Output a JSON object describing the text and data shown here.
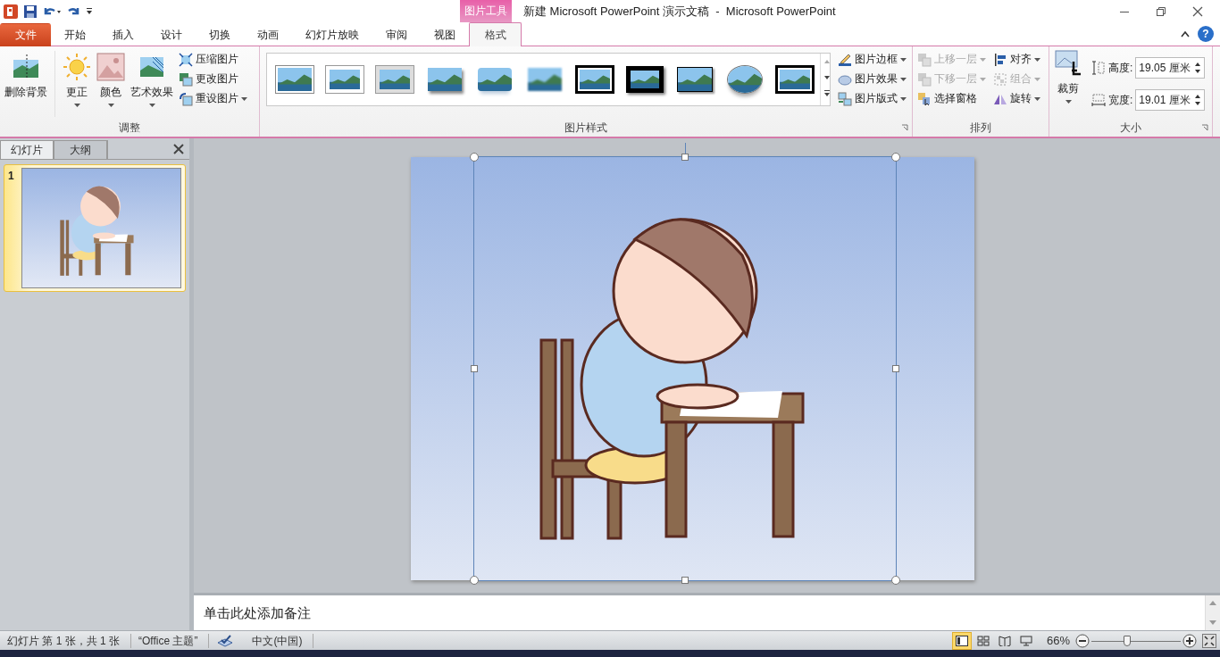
{
  "title_bar": {
    "title": "新建 Microsoft PowerPoint 演示文稿  -  Microsoft PowerPoint",
    "context_tab_group": "图片工具"
  },
  "tabs": [
    {
      "label": "文件",
      "kind": "file",
      "selected": false
    },
    {
      "label": "开始",
      "kind": "normal",
      "selected": false
    },
    {
      "label": "插入",
      "kind": "normal",
      "selected": false
    },
    {
      "label": "设计",
      "kind": "normal",
      "selected": false
    },
    {
      "label": "切换",
      "kind": "normal",
      "selected": false
    },
    {
      "label": "动画",
      "kind": "normal",
      "selected": false
    },
    {
      "label": "幻灯片放映",
      "kind": "normal",
      "selected": false
    },
    {
      "label": "审阅",
      "kind": "normal",
      "selected": false
    },
    {
      "label": "视图",
      "kind": "normal",
      "selected": false
    },
    {
      "label": "格式",
      "kind": "context",
      "selected": true
    }
  ],
  "help": "?",
  "ribbon": {
    "adjust": {
      "label": "调整",
      "buttons": [
        {
          "label": "删除背景",
          "kind": "remove-background",
          "dropdown": false
        },
        {
          "label": "更正",
          "kind": "corrections",
          "dropdown": true
        },
        {
          "label": "颜色",
          "kind": "color",
          "dropdown": true
        },
        {
          "label": "艺术效果",
          "kind": "artistic",
          "dropdown": true
        }
      ],
      "small_buttons": [
        {
          "label": "压缩图片",
          "kind": "compress",
          "dropdown": false
        },
        {
          "label": "更改图片",
          "kind": "change",
          "dropdown": false
        },
        {
          "label": "重设图片",
          "kind": "reset",
          "dropdown": true
        }
      ]
    },
    "picture_styles": {
      "label": "图片样式",
      "launcher": true,
      "styles": [
        {
          "kind": "thin-frame"
        },
        {
          "kind": "white-frame"
        },
        {
          "kind": "gray-frame"
        },
        {
          "kind": "shadow"
        },
        {
          "kind": "reflection"
        },
        {
          "kind": "soft-edge"
        },
        {
          "kind": "double-black"
        },
        {
          "kind": "black-shadow"
        },
        {
          "kind": "thin-black"
        },
        {
          "kind": "oval"
        },
        {
          "kind": "double-black"
        }
      ],
      "commands": [
        {
          "label": "图片边框",
          "kind": "border",
          "dropdown": true
        },
        {
          "label": "图片效果",
          "kind": "effects",
          "dropdown": true
        },
        {
          "label": "图片版式",
          "kind": "layout",
          "dropdown": true
        }
      ]
    },
    "arrange": {
      "label": "排列",
      "commands": [
        {
          "label": "上移一层",
          "kind": "bring-forward",
          "dropdown": true,
          "disabled": true
        },
        {
          "label": "对齐",
          "kind": "align",
          "dropdown": true,
          "disabled": false
        },
        {
          "label": "下移一层",
          "kind": "send-backward",
          "dropdown": true,
          "disabled": true
        },
        {
          "label": "组合",
          "kind": "group",
          "dropdown": true,
          "disabled": true
        },
        {
          "label": "选择窗格",
          "kind": "selection-pane",
          "dropdown": false,
          "disabled": false
        },
        {
          "label": "旋转",
          "kind": "rotate",
          "dropdown": true,
          "disabled": false
        }
      ]
    },
    "size": {
      "label": "大小",
      "launcher": true,
      "crop": {
        "label": "裁剪",
        "dropdown": true
      },
      "fields": [
        {
          "label": "高度:",
          "kind": "height",
          "value": "19.05 厘米"
        },
        {
          "label": "宽度:",
          "kind": "width",
          "value": "19.01 厘米"
        }
      ]
    }
  },
  "slides_pane": {
    "tabs": [
      {
        "label": "幻灯片",
        "selected": true
      },
      {
        "label": "大纲",
        "selected": false
      }
    ],
    "slides": [
      {
        "number": "1",
        "selected": true
      }
    ]
  },
  "slide": {
    "picture_selected": true
  },
  "notes": {
    "placeholder": "单击此处添加备注"
  },
  "status_bar": {
    "items": [
      "幻灯片 第 1 张，共 1 张",
      "“Office 主题”"
    ],
    "language": "中文(中国)",
    "views": [
      {
        "kind": "normal",
        "selected": true
      },
      {
        "kind": "sorter",
        "selected": false
      },
      {
        "kind": "reading",
        "selected": false
      },
      {
        "kind": "slideshow",
        "selected": false
      }
    ],
    "zoom": "66%",
    "zoom_slider": {
      "level": 0.4
    }
  }
}
